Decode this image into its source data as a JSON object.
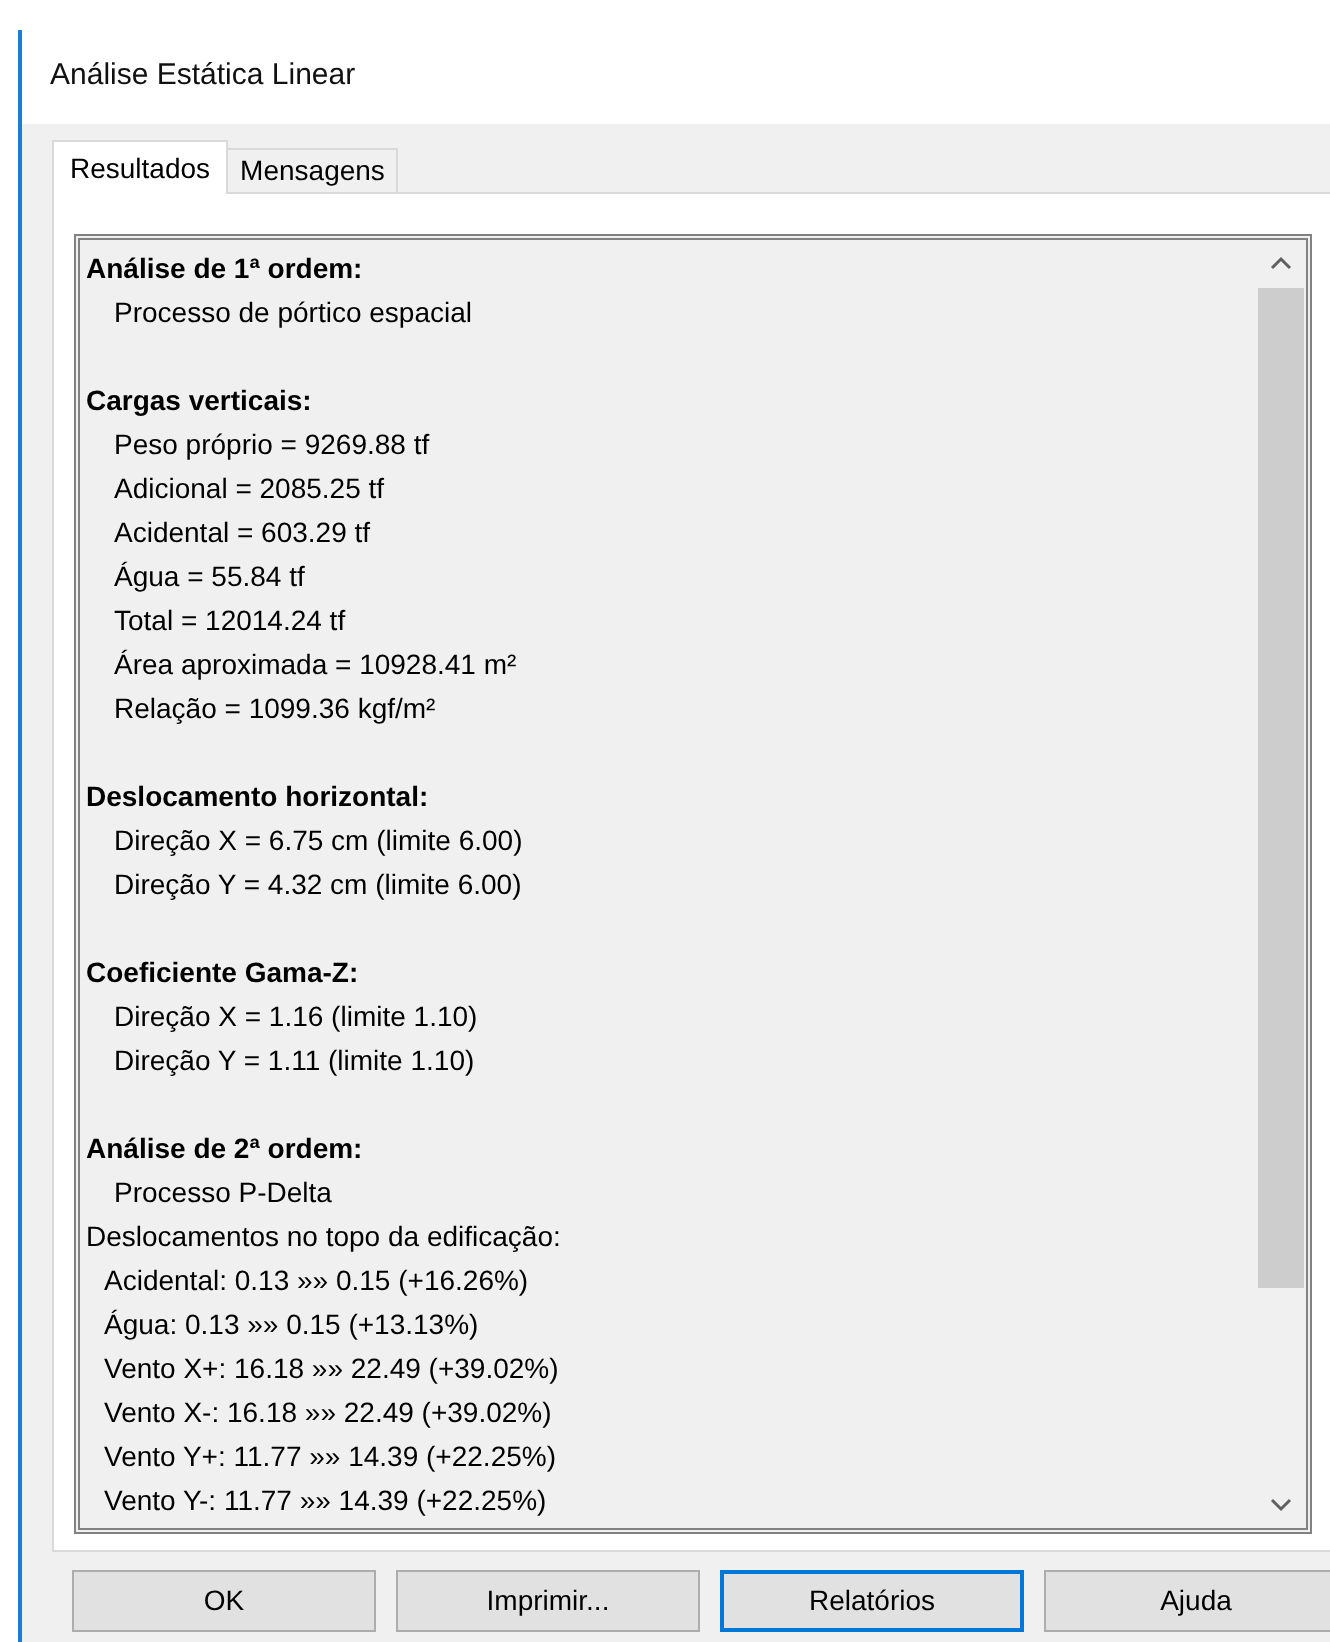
{
  "window": {
    "title": "Análise Estática Linear"
  },
  "tabs": [
    {
      "label": "Resultados",
      "selected": true
    },
    {
      "label": "Mensagens",
      "selected": false
    }
  ],
  "report": {
    "sections": [
      {
        "heading": "Análise de 1ª ordem:",
        "lines": [
          {
            "kind": "item",
            "text": "Processo de pórtico espacial"
          }
        ]
      },
      {
        "heading": "Cargas verticais:",
        "lines": [
          {
            "kind": "item",
            "text": "Peso próprio = 9269.88 tf"
          },
          {
            "kind": "item",
            "text": "Adicional = 2085.25 tf"
          },
          {
            "kind": "item",
            "text": "Acidental = 603.29 tf"
          },
          {
            "kind": "item",
            "text": "Água = 55.84 tf"
          },
          {
            "kind": "item",
            "text": "Total = 12014.24 tf"
          },
          {
            "kind": "item",
            "text": "Área aproximada = 10928.41 m²"
          },
          {
            "kind": "item",
            "text": "Relação = 1099.36 kgf/m²"
          }
        ]
      },
      {
        "heading": "Deslocamento horizontal:",
        "lines": [
          {
            "kind": "item",
            "text": "Direção X = 6.75 cm (limite 6.00)"
          },
          {
            "kind": "item",
            "text": "Direção Y = 4.32 cm (limite 6.00)"
          }
        ]
      },
      {
        "heading": "Coeficiente Gama-Z:",
        "lines": [
          {
            "kind": "item",
            "text": "Direção X = 1.16 (limite 1.10)"
          },
          {
            "kind": "item",
            "text": "Direção Y = 1.11 (limite 1.10)"
          }
        ]
      },
      {
        "heading": "Análise de 2ª ordem:",
        "lines": [
          {
            "kind": "item",
            "text": "Processo P-Delta"
          },
          {
            "kind": "label",
            "text": "Deslocamentos no topo da edificação:"
          },
          {
            "kind": "subitem",
            "text": "Acidental: 0.13 »» 0.15 (+16.26%)"
          },
          {
            "kind": "subitem",
            "text": "Água: 0.13 »» 0.15 (+13.13%)"
          },
          {
            "kind": "subitem",
            "text": "Vento X+: 16.18 »» 22.49 (+39.02%)"
          },
          {
            "kind": "subitem",
            "text": "Vento X-: 16.18 »» 22.49 (+39.02%)"
          },
          {
            "kind": "subitem",
            "text": "Vento Y+: 11.77 »» 14.39 (+22.25%)"
          },
          {
            "kind": "subitem",
            "text": "Vento Y-: 11.77 »» 14.39 (+22.25%)"
          }
        ]
      }
    ]
  },
  "buttons": [
    {
      "label": "OK",
      "focused": false
    },
    {
      "label": "Imprimir...",
      "focused": false
    },
    {
      "label": "Relatórios",
      "focused": true
    },
    {
      "label": "Ajuda",
      "focused": false
    }
  ]
}
